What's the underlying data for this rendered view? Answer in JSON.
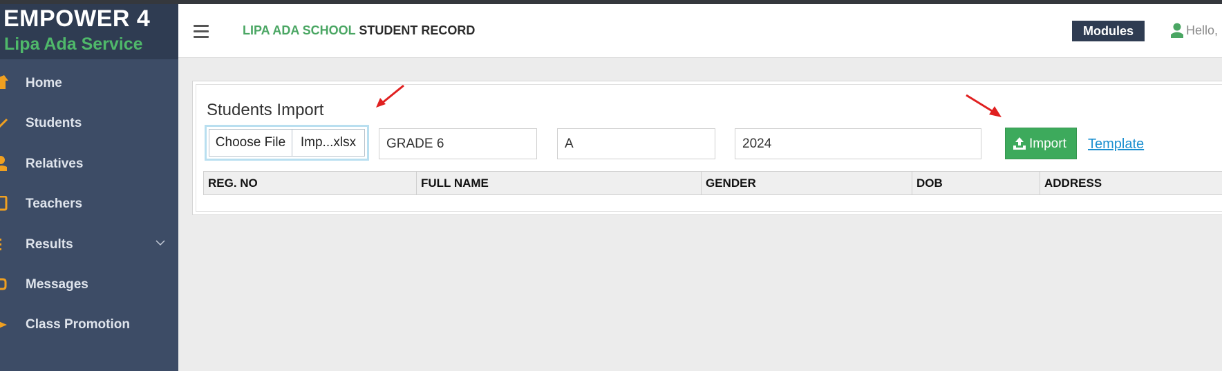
{
  "brand": {
    "title": "EMPOWER 4",
    "subtitle": "Lipa Ada Service"
  },
  "sidebar": {
    "items": [
      {
        "label": "Home",
        "icon": "home-icon"
      },
      {
        "label": "Students",
        "icon": "check-icon"
      },
      {
        "label": "Relatives",
        "icon": "user-icon"
      },
      {
        "label": "Teachers",
        "icon": "tablet-icon"
      },
      {
        "label": "Results",
        "icon": "list-icon",
        "has_submenu": true
      },
      {
        "label": "Messages",
        "icon": "message-icon"
      },
      {
        "label": "Class Promotion",
        "icon": "graduation-cap-icon"
      }
    ]
  },
  "header": {
    "school_name": "LIPA ADA SCHOOL",
    "record_title": "STUDENT RECORD",
    "modules_label": "Modules",
    "greeting": "Hello,"
  },
  "import_panel": {
    "title": "Students Import",
    "file_button_label": "Choose File",
    "file_name": "Imp...xlsx",
    "grade_value": "GRADE 6",
    "stream_value": "A",
    "year_value": "2024",
    "import_button_label": "Import",
    "template_link_label": "Template"
  },
  "table": {
    "columns": [
      "REG. NO",
      "FULL NAME",
      "GENDER",
      "DOB",
      "ADDRESS"
    ]
  },
  "colors": {
    "sidebar": "#3d4c66",
    "brand_bg": "#2f3c52",
    "accent_green": "#3daa5c",
    "icon_orange": "#f0a020",
    "link_blue": "#1a8fd0",
    "annotation_arrow": "#e02020"
  }
}
